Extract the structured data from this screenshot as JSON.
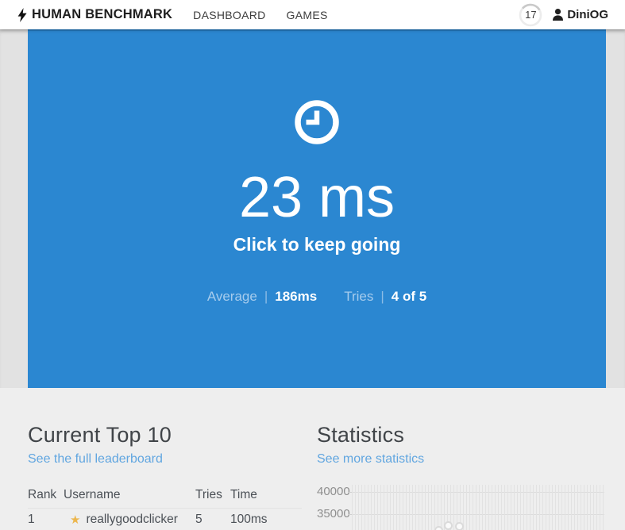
{
  "header": {
    "brand": "HUMAN BENCHMARK",
    "nav": [
      {
        "label": "DASHBOARD"
      },
      {
        "label": "GAMES"
      }
    ],
    "level": "17",
    "username": "DiniOG"
  },
  "hero": {
    "result": "23 ms",
    "prompt": "Click to keep going",
    "stats": [
      {
        "label": "Average",
        "sep": "|",
        "value": "186ms"
      },
      {
        "label": "Tries",
        "sep": "|",
        "value": "4 of 5"
      }
    ]
  },
  "leaderboard": {
    "title": "Current Top 10",
    "link": "See the full leaderboard",
    "columns": [
      "Rank",
      "Username",
      "Tries",
      "Time"
    ],
    "rows": [
      {
        "rank": "1",
        "starred": true,
        "username": "reallygoodclicker",
        "tries": "5",
        "time": "100ms"
      }
    ]
  },
  "statistics": {
    "title": "Statistics",
    "link": "See more statistics",
    "chart_data": {
      "type": "line",
      "title": "",
      "xlabel": "",
      "ylabel": "",
      "y_ticks": [
        40000,
        35000
      ],
      "y_tick_interval": 5000,
      "grid": "minor-vertical-and-horizontal",
      "legend": false,
      "cropped": true,
      "visible_points": [
        {
          "x_frac": 0.345,
          "value": 31300
        },
        {
          "x_frac": 0.383,
          "value": 32500
        },
        {
          "x_frac": 0.425,
          "value": 32300
        }
      ]
    }
  },
  "icons": {
    "brand": "lightning-bolt-icon",
    "user": "person-icon",
    "hero": "clock-icon",
    "leaderboard": "star-icon"
  },
  "colors": {
    "accent_blue": "#2b87d1",
    "link_blue": "#61a6e0",
    "star_gold": "#ecb64d",
    "page_gray": "#e2e2e2",
    "section_gray": "#eeeeee"
  }
}
